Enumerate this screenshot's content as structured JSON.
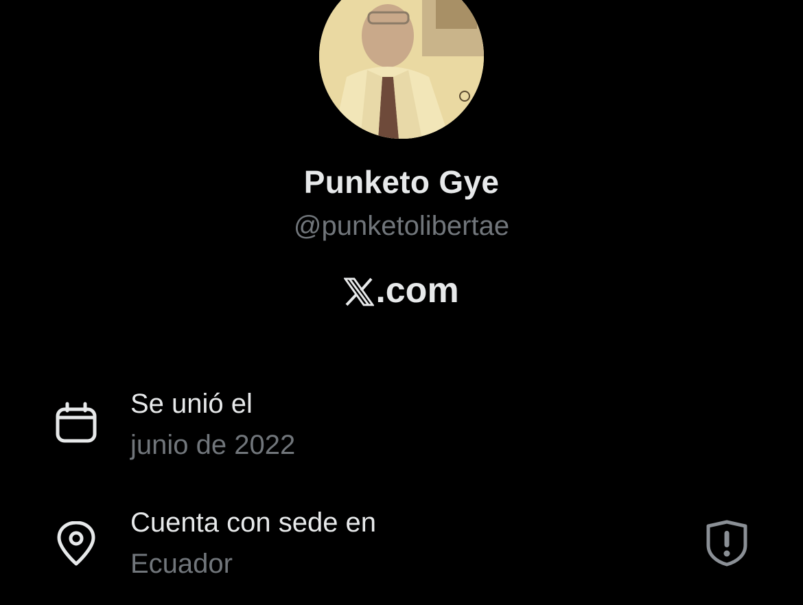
{
  "profile": {
    "display_name": "Punketo Gye",
    "handle": "@punketolibertae",
    "brand_suffix": ".com",
    "brand_icon": "x-logo-icon"
  },
  "about": {
    "joined_label": "Se unió el",
    "joined_value": "junio de 2022",
    "joined_icon": "calendar-icon",
    "location_label": "Cuenta con sede en",
    "location_value": "Ecuador",
    "location_icon": "location-pin-icon",
    "verification_icon": "shield-alert-icon"
  },
  "colors": {
    "background": "#000000",
    "primary_text": "#e7e9ea",
    "secondary_text": "#71767b"
  }
}
